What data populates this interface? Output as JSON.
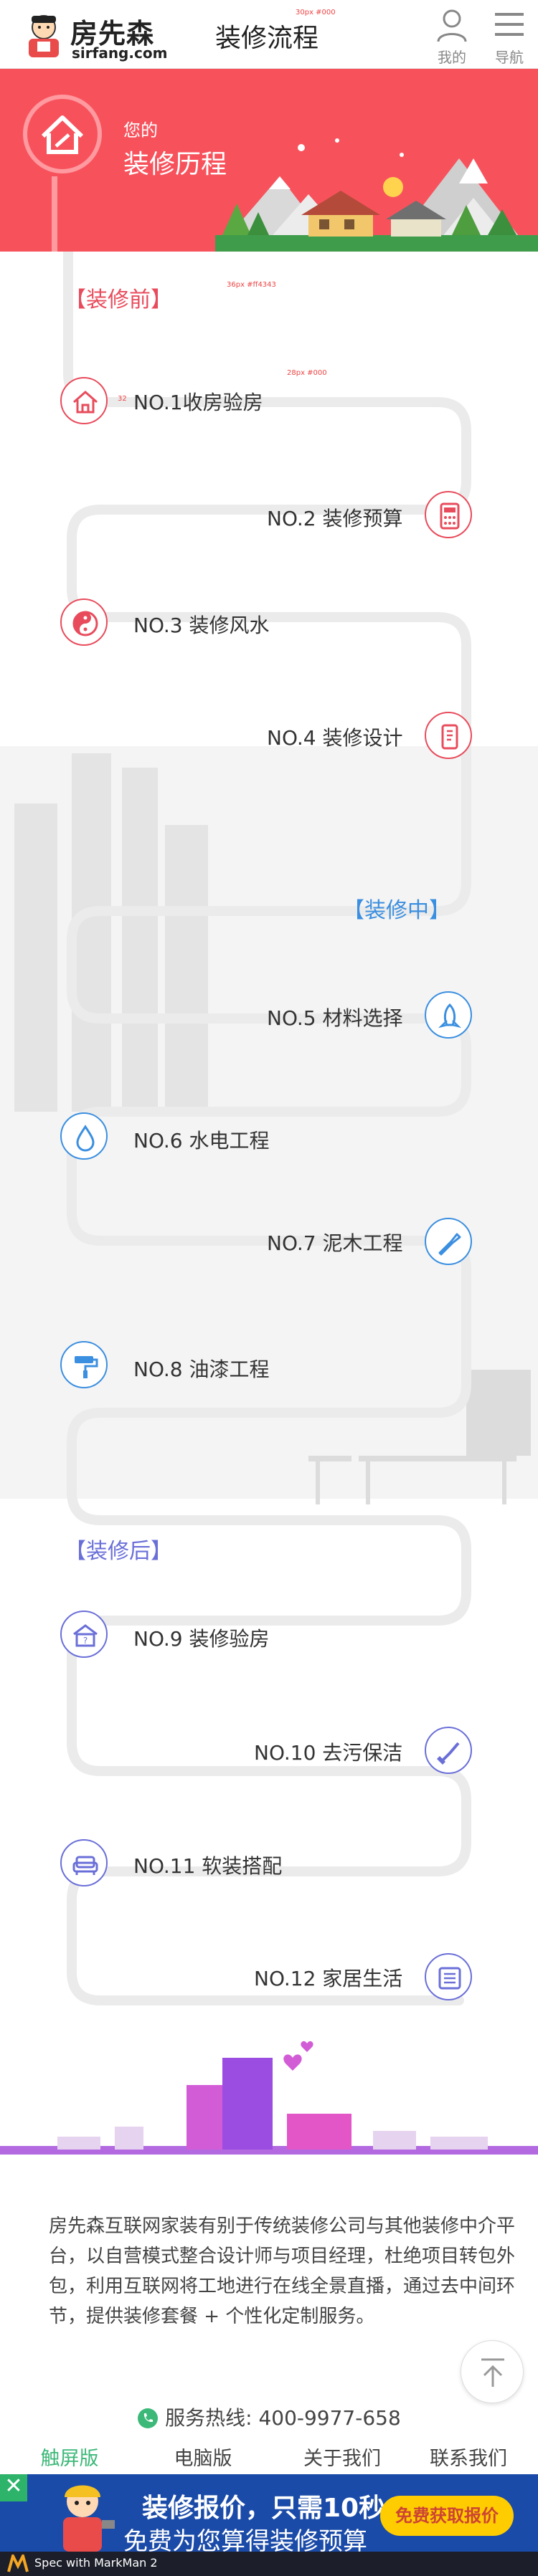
{
  "header": {
    "logo_cn": "房先森",
    "logo_en": "sirfang.com",
    "title": "装修流程",
    "mine_label": "我的",
    "nav_label": "导航"
  },
  "banner": {
    "line1": "您的",
    "line2": "装修历程"
  },
  "annotations": {
    "a1": "36px #ff4343",
    "a2": "30px #000",
    "a3": "28px #000",
    "a4": "32"
  },
  "sections": {
    "before": "【装修前】",
    "during": "【装修中】",
    "after": "【装修后】"
  },
  "steps": [
    {
      "label": "NO.1收房验房",
      "icon": "house-icon"
    },
    {
      "label": "NO.2 装修预算",
      "icon": "calculator-icon"
    },
    {
      "label": "NO.3 装修风水",
      "icon": "yin-yang-icon"
    },
    {
      "label": "NO.4 装修设计",
      "icon": "design-doc-icon"
    },
    {
      "label": "NO.5 材料选择",
      "icon": "rocket-icon"
    },
    {
      "label": "NO.6 水电工程",
      "icon": "water-drop-icon"
    },
    {
      "label": "NO.7 泥木工程",
      "icon": "trowel-icon"
    },
    {
      "label": "NO.8 油漆工程",
      "icon": "paint-roller-icon"
    },
    {
      "label": "NO.9 装修验房",
      "icon": "inspection-icon"
    },
    {
      "label": "NO.10 去污保洁",
      "icon": "cleaning-icon"
    },
    {
      "label": "NO.11 软装搭配",
      "icon": "sofa-icon"
    },
    {
      "label": "NO.12 家居生活",
      "icon": "home-life-icon"
    }
  ],
  "about": {
    "text": "房先森互联网家装有别于传统装修公司与其他装修中介平台，以自营模式整合设计师与项目经理，杜绝项目转包外包，利用互联网将工地进行在线全景直播，通过去中间环节，提供装修套餐 + 个性化定制服务。"
  },
  "hotline": "服务热线: 400-9977-658",
  "footer_nav": [
    "触屏版",
    "电脑版",
    "关于我们",
    "联系我们"
  ],
  "promo": {
    "line1": "装修报价，只需10秒",
    "line2": "免费为您算得装修预算",
    "button": "免费获取报价",
    "close": "✕",
    "markman": "Spec with MarkMan 2"
  },
  "colors": {
    "brand_red": "#f7525c",
    "before": "#e84c5c",
    "during": "#3b8fe0",
    "after": "#6a6fd8"
  }
}
